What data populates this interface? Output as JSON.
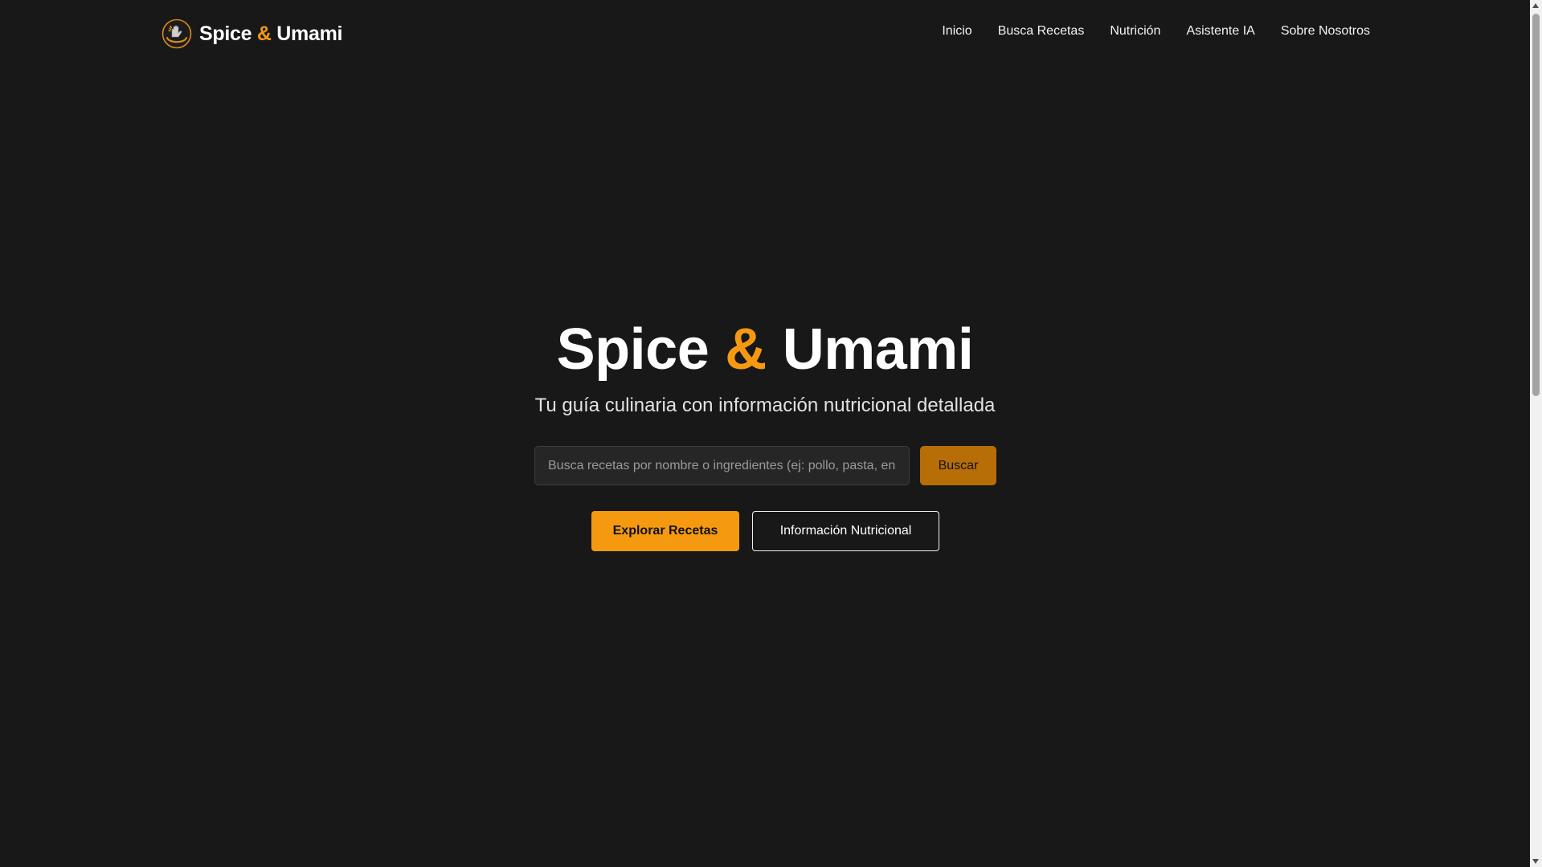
{
  "brand": {
    "logo_icon": "chef-hand-logo-icon",
    "name_part1": "Spice",
    "ampersand": "&",
    "name_part2": "Umami"
  },
  "nav": {
    "items": [
      {
        "label": "Inicio"
      },
      {
        "label": "Busca Recetas"
      },
      {
        "label": "Nutrición"
      },
      {
        "label": "Asistente IA"
      },
      {
        "label": "Sobre Nosotros"
      }
    ]
  },
  "hero": {
    "title_part1": "Spice",
    "title_ampersand": "&",
    "title_part2": "Umami",
    "subtitle": "Tu guía culinaria con información nutricional detallada",
    "search": {
      "placeholder": "Busca recetas por nombre o ingredientes (ej: pollo, pasta, ens",
      "value": "",
      "button_label": "Buscar"
    },
    "cta_primary": "Explorar Recetas",
    "cta_secondary": "Información Nutricional"
  },
  "colors": {
    "background": "#181818",
    "accent": "#f59a10",
    "search_button": "#b76e06",
    "text": "#ffffff"
  }
}
